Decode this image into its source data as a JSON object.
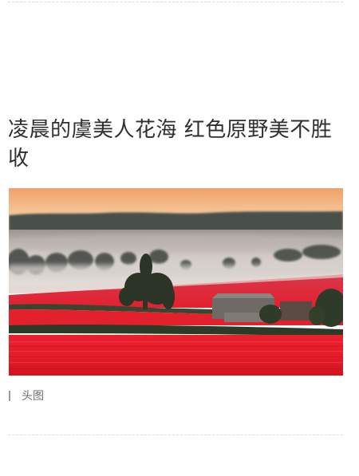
{
  "article": {
    "title": "凌晨的虞美人花海 红色原野美不胜收",
    "source_label": "头图"
  },
  "photo": {
    "subject": "foggy-sunrise-poppy-field",
    "colors": {
      "sky_top": "#f2a36a",
      "sky_bottom": "#f8d2a6",
      "fog": "#d9d3cf",
      "poppy": "#e0202e",
      "poppy_dark": "#b5121f",
      "hedge": "#2e3a26"
    }
  }
}
